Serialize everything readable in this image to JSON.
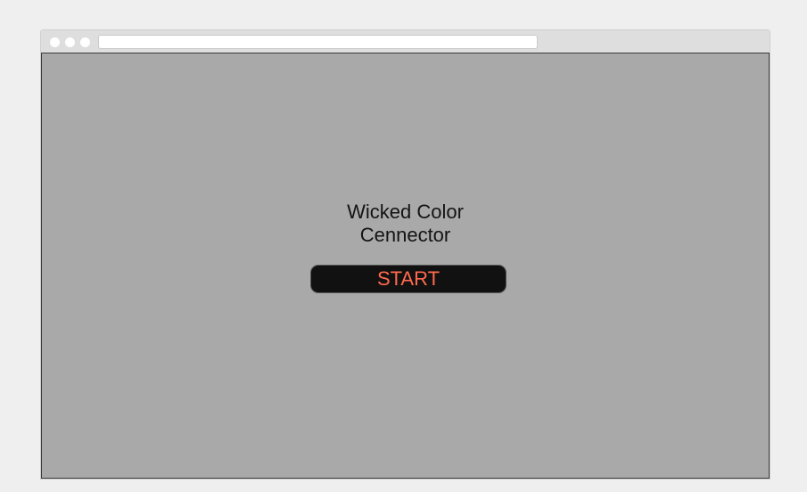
{
  "browser": {
    "address": ""
  },
  "game": {
    "title_line1": "Wicked Color",
    "title_line2": "Cennector",
    "start_label": "START"
  },
  "colors": {
    "page_background": "#efefef",
    "viewport_background": "#a9a9a9",
    "button_background": "#111111",
    "button_text": "#ff6a4d",
    "title_text": "#141414"
  }
}
